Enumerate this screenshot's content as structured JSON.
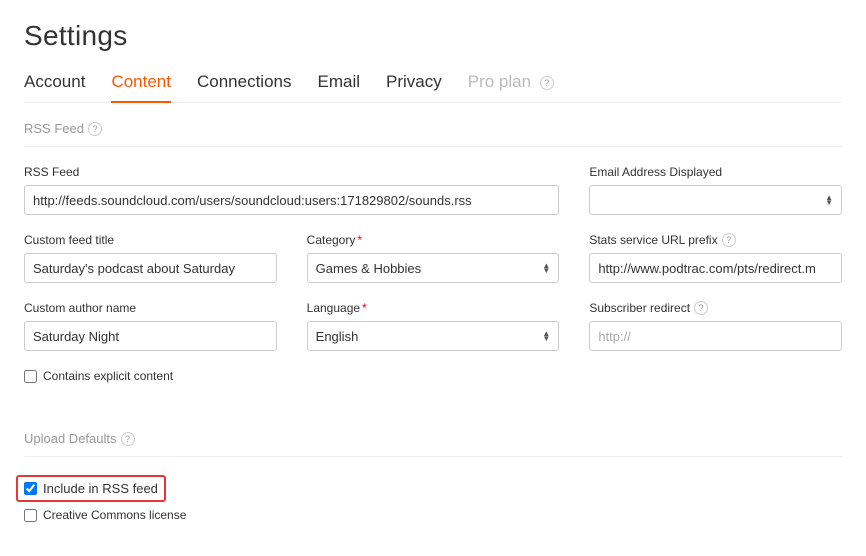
{
  "page_title": "Settings",
  "tabs": {
    "account": "Account",
    "content": "Content",
    "connections": "Connections",
    "email": "Email",
    "privacy": "Privacy",
    "pro": "Pro plan"
  },
  "sections": {
    "rss_feed_header": "RSS Feed",
    "upload_defaults_header": "Upload Defaults"
  },
  "fields": {
    "rss_feed_label": "RSS Feed",
    "rss_feed_value": "http://feeds.soundcloud.com/users/soundcloud:users:171829802/sounds.rss",
    "email_displayed_label": "Email Address Displayed",
    "email_displayed_value": "",
    "custom_title_label": "Custom feed title",
    "custom_title_value": "Saturday's podcast about Saturday",
    "category_label": "Category",
    "category_value": "Games & Hobbies",
    "stats_url_label": "Stats service URL prefix",
    "stats_url_value": "http://www.podtrac.com/pts/redirect.m",
    "author_label": "Custom author name",
    "author_value": "Saturday Night",
    "language_label": "Language",
    "language_value": "English",
    "subscriber_redirect_label": "Subscriber redirect",
    "subscriber_redirect_placeholder": "http://",
    "explicit_label": "Contains explicit content",
    "include_rss_label": "Include in RSS feed",
    "cc_license_label": "Creative Commons license"
  },
  "help_glyph": "?"
}
